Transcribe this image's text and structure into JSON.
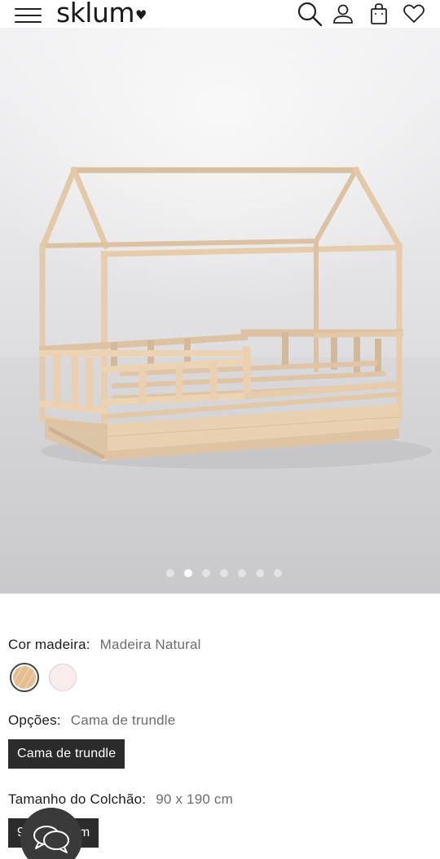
{
  "header": {
    "logo_text": "sklum",
    "logo_heart": "♥",
    "icons": [
      "menu-icon",
      "search-icon",
      "user-icon",
      "bag-icon",
      "heart-icon"
    ]
  },
  "gallery": {
    "dot_count": 7,
    "active_index": 1
  },
  "wood_color": {
    "label": "Cor madeira:",
    "value": "Madeira Natural",
    "swatches": [
      "natural",
      "pink"
    ]
  },
  "options": {
    "label": "Opções:",
    "value": "Cama de trundle",
    "button_label": "Cama de trundle"
  },
  "mattress": {
    "label": "Tamanho do Colchão:",
    "value": "90 x 190 cm",
    "button_label": "90 x 190 cm"
  },
  "colors": {
    "accent_dark": "#2b2b2b",
    "swatch_pink": "#f8ecec"
  }
}
